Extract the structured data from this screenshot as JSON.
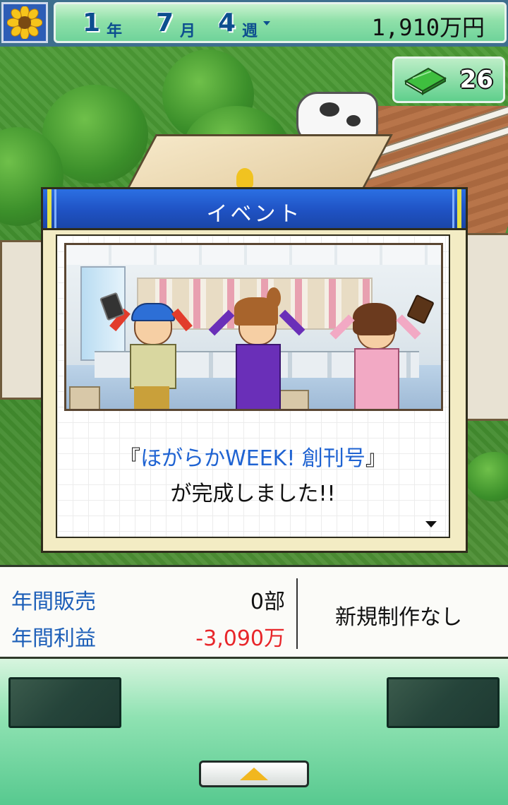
{
  "top_bar": {
    "year_num": "1",
    "year_unit": "年",
    "month_num": "7",
    "month_unit": "月",
    "week_num": "4",
    "week_unit": "週",
    "money": "1,910万円"
  },
  "book_counter": {
    "count": "26",
    "icon": "green-book-icon"
  },
  "event_dialog": {
    "title": "イベント",
    "message_open": "『",
    "message_title": "ほがらかWEEK! 創刊号",
    "message_close": "』",
    "message_line2": "が完成しました!!"
  },
  "stats": {
    "annual_sales_label": "年間販売",
    "annual_sales_value": "0部",
    "annual_profit_label": "年間利益",
    "annual_profit_value": "-3,090万",
    "new_production": "新規制作なし"
  },
  "colors": {
    "profit_negative": "#e8262a",
    "label_blue": "#1d5fb8",
    "dialog_title_blue": "#1f52c3"
  }
}
